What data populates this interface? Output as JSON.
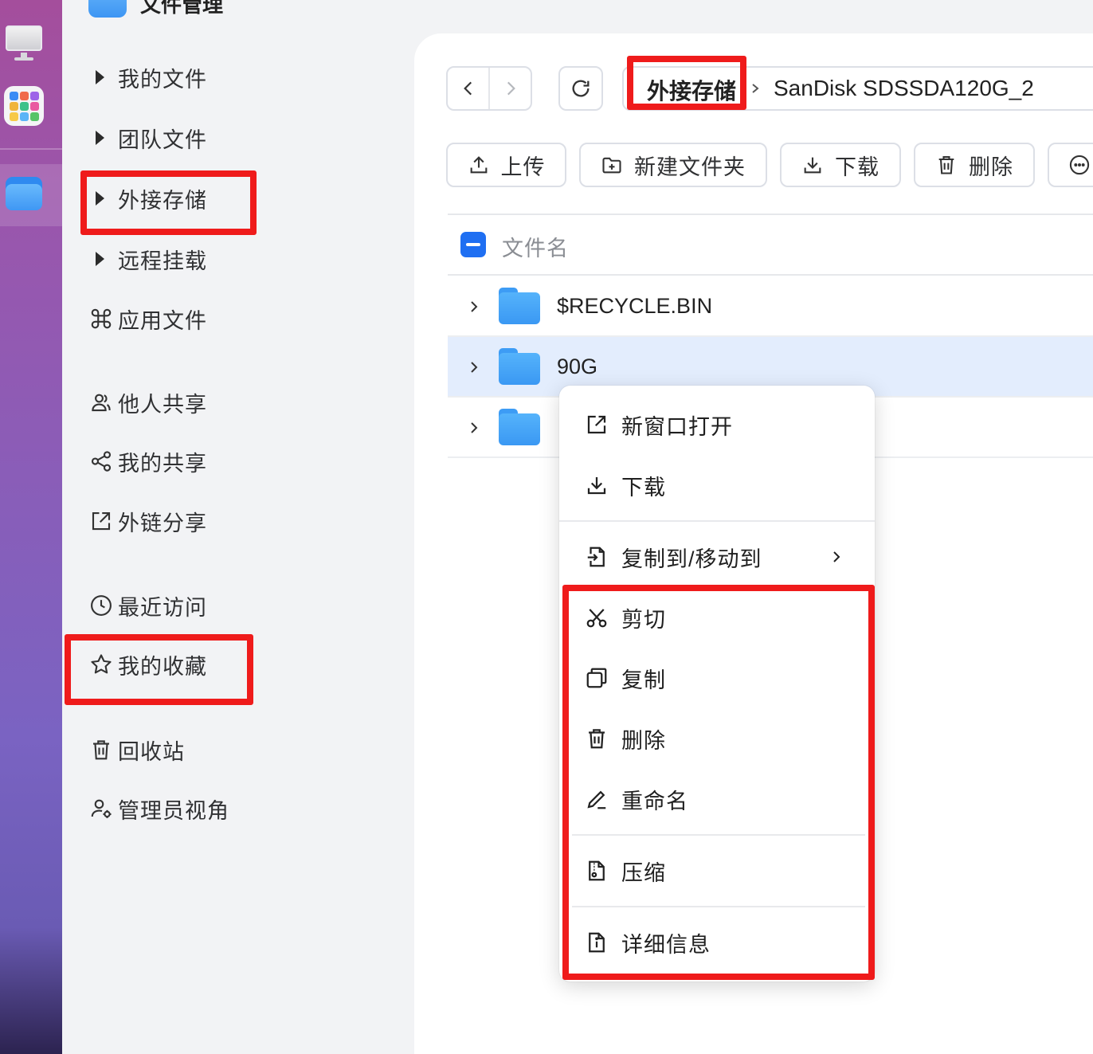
{
  "app": {
    "title": "文件管理"
  },
  "sidebar": {
    "items": [
      {
        "label": "我的文件",
        "icon": "caret-right-icon"
      },
      {
        "label": "团队文件",
        "icon": "caret-right-icon"
      },
      {
        "label": "外接存储",
        "icon": "caret-right-icon"
      },
      {
        "label": "远程挂载",
        "icon": "caret-right-icon"
      },
      {
        "label": "应用文件",
        "icon": "command-icon"
      },
      {
        "label": "他人共享",
        "icon": "users-icon"
      },
      {
        "label": "我的共享",
        "icon": "share-icon"
      },
      {
        "label": "外链分享",
        "icon": "external-share-icon"
      },
      {
        "label": "最近访问",
        "icon": "clock-icon"
      },
      {
        "label": "我的收藏",
        "icon": "star-icon"
      },
      {
        "label": "回收站",
        "icon": "trash-icon"
      },
      {
        "label": "管理员视角",
        "icon": "admin-icon"
      }
    ]
  },
  "breadcrumb": {
    "items": [
      "外接存储",
      "SanDisk SDSSDA120G_2"
    ]
  },
  "toolbar": {
    "upload": "上传",
    "new_folder": "新建文件夹",
    "download": "下载",
    "delete": "删除"
  },
  "list": {
    "header": "文件名",
    "rows": [
      {
        "name": "$RECYCLE.BIN",
        "selected": false
      },
      {
        "name": "90G",
        "selected": true
      },
      {
        "name": "",
        "selected": false
      }
    ]
  },
  "context_menu": {
    "items": [
      {
        "label": "新窗口打开",
        "icon": "open-new-window-icon"
      },
      {
        "label": "下载",
        "icon": "download-icon"
      },
      {
        "label": "复制到/移动到",
        "icon": "copy-move-icon",
        "submenu": true
      },
      {
        "label": "剪切",
        "icon": "scissors-icon"
      },
      {
        "label": "复制",
        "icon": "copy-icon"
      },
      {
        "label": "删除",
        "icon": "trash-icon"
      },
      {
        "label": "重命名",
        "icon": "pencil-icon"
      },
      {
        "label": "压缩",
        "icon": "zip-file-icon"
      },
      {
        "label": "详细信息",
        "icon": "info-file-icon"
      }
    ]
  },
  "colors": {
    "highlight": "#ef1b1b",
    "accent": "#1f6ff2",
    "selected_row": "#e3edfd"
  }
}
